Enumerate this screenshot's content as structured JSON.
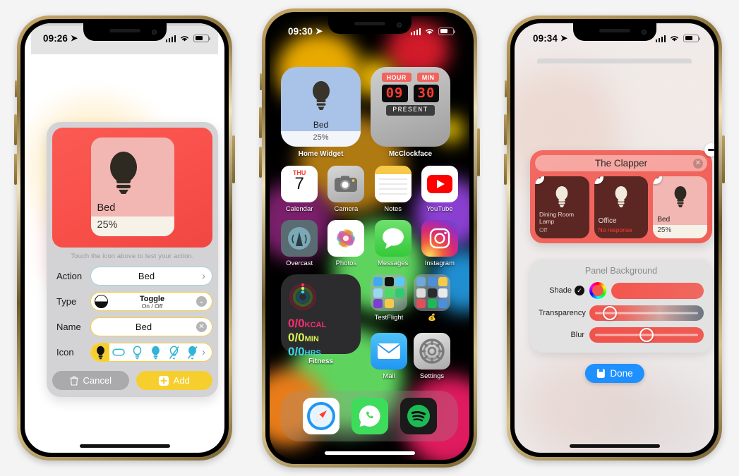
{
  "phone1": {
    "status": {
      "time": "09:26",
      "location_icon": "location-arrow-icon",
      "signal_icon": "cellular-signal-icon",
      "wifi_icon": "wifi-icon",
      "battery_icon": "battery-icon"
    },
    "preview": {
      "name": "Bed",
      "percent": "25%",
      "icon": "lightbulb-icon"
    },
    "hint": "Touch the icon above to test your action.",
    "fields": {
      "action": {
        "label": "Action",
        "value": "Bed",
        "chevron": "chevron-right-icon"
      },
      "type": {
        "label": "Type",
        "value": "Toggle",
        "sub": "On / Off",
        "chevron": "chevron-down-icon"
      },
      "name": {
        "label": "Name",
        "value": "Bed",
        "clear": "clear-icon"
      },
      "icon": {
        "label": "Icon",
        "chevron": "chevron-right-icon",
        "options": [
          "lightbulb-filled-icon",
          "capsule-outline-icon",
          "lightbulb-outline-icon",
          "lightbulb-fill-blue-icon",
          "lightbulb-slash-outline-icon",
          "lightbulb-slash-fill-icon"
        ]
      }
    },
    "buttons": {
      "cancel": "Cancel",
      "cancel_icon": "trash-icon",
      "add": "Add",
      "add_icon": "plus-square-icon"
    }
  },
  "phone2": {
    "status": {
      "time": "09:30"
    },
    "widgets": [
      {
        "label": "Home Widget",
        "name": "Bed",
        "percent": "25%",
        "icon": "lightbulb-icon"
      },
      {
        "label": "McClockface",
        "hour_head": "HOUR",
        "min_head": "MIN",
        "hour": "09",
        "min": "30",
        "present": "PRESENT"
      }
    ],
    "apps_row1": [
      {
        "label": "Calendar",
        "icon": "calendar-icon",
        "weekday": "THU",
        "day": "7"
      },
      {
        "label": "Camera",
        "icon": "camera-icon"
      },
      {
        "label": "Notes",
        "icon": "notes-icon"
      },
      {
        "label": "YouTube",
        "icon": "youtube-icon"
      }
    ],
    "apps_row2": [
      {
        "label": "Overcast",
        "icon": "overcast-icon"
      },
      {
        "label": "Photos",
        "icon": "photos-icon"
      },
      {
        "label": "Messages",
        "icon": "messages-icon"
      },
      {
        "label": "Instagram",
        "icon": "instagram-icon"
      }
    ],
    "fitness": {
      "label": "Fitness",
      "move": "0/0",
      "move_unit": "KCAL",
      "exercise": "0/0",
      "exercise_unit": "MIN",
      "stand": "0/0",
      "stand_unit": "HRS"
    },
    "folders": [
      {
        "label": "TestFlight",
        "icon": "folder-icon"
      },
      {
        "label": "💰",
        "icon": "folder-icon"
      }
    ],
    "apps_row3b": [
      {
        "label": "Mail",
        "icon": "mail-icon"
      },
      {
        "label": "Settings",
        "icon": "settings-gear-icon"
      }
    ],
    "dock": [
      {
        "label": "Safari",
        "icon": "safari-icon"
      },
      {
        "label": "WhatsApp",
        "icon": "whatsapp-icon"
      },
      {
        "label": "Spotify",
        "icon": "spotify-icon"
      }
    ]
  },
  "phone3": {
    "status": {
      "time": "09:34"
    },
    "clapper": {
      "title": "The Clapper",
      "close_icon": "close-icon",
      "tiles": [
        {
          "name": "Dining Room Lamp",
          "state": "Off",
          "state_error": false,
          "icon": "lightbulb-icon",
          "on": false
        },
        {
          "name": "Office",
          "state": "No response",
          "state_error": true,
          "icon": "lightbulb-icon",
          "on": false
        },
        {
          "name": "Bed",
          "state": "25%",
          "state_error": false,
          "icon": "lightbulb-icon",
          "on": true
        }
      ]
    },
    "panel": {
      "title": "Panel Background",
      "shade": {
        "label": "Shade",
        "check_icon": "check-circle-icon",
        "color": "#f4554d"
      },
      "transparency": {
        "label": "Transparency",
        "knob_pct": 18
      },
      "blur": {
        "label": "Blur",
        "knob_pct": 50
      }
    },
    "done": {
      "label": "Done",
      "icon": "save-icon"
    }
  },
  "colors": {
    "accent_red": "#f4554d",
    "accent_yellow": "#f6cf2f",
    "accent_blue": "#1e90ff",
    "page_bg": "#f4f4f4"
  }
}
